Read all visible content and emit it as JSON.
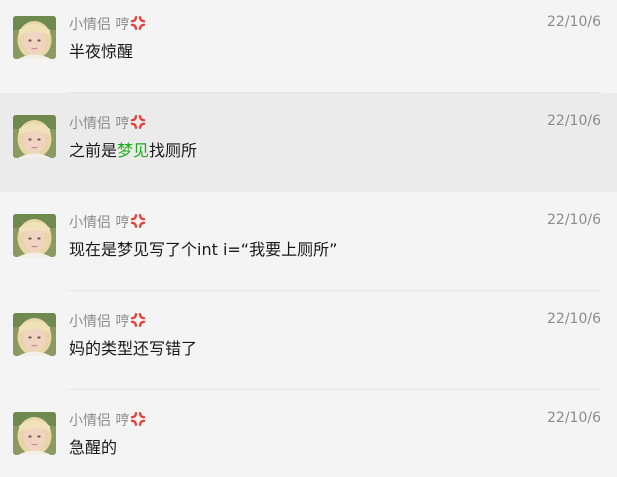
{
  "colors": {
    "background": "#f4f4f4",
    "highlight_row": "#ebebeb",
    "name_text": "#8c8c8c",
    "message_text": "#191919",
    "link_green": "#1aad19",
    "anger_emoji": "#e8413c"
  },
  "messages": [
    {
      "avatar": "avatar-photo",
      "name": "小情侣 哼",
      "emoji": "anger-symbol-icon",
      "time": "22/10/6",
      "text_parts": [
        {
          "text": "半夜惊醒",
          "style": "normal"
        }
      ],
      "highlighted": false
    },
    {
      "avatar": "avatar-photo",
      "name": "小情侣 哼",
      "emoji": "anger-symbol-icon",
      "time": "22/10/6",
      "text_parts": [
        {
          "text": "之前是",
          "style": "normal"
        },
        {
          "text": "梦见",
          "style": "green"
        },
        {
          "text": "找厕所",
          "style": "normal"
        }
      ],
      "highlighted": true
    },
    {
      "avatar": "avatar-photo",
      "name": "小情侣 哼",
      "emoji": "anger-symbol-icon",
      "time": "22/10/6",
      "text_parts": [
        {
          "text": "现在是梦见写了个int i=“我要上厕所”",
          "style": "normal"
        }
      ],
      "highlighted": false
    },
    {
      "avatar": "avatar-photo",
      "name": "小情侣 哼",
      "emoji": "anger-symbol-icon",
      "time": "22/10/6",
      "text_parts": [
        {
          "text": "妈的类型还写错了",
          "style": "normal"
        }
      ],
      "highlighted": false
    },
    {
      "avatar": "avatar-photo",
      "name": "小情侣 哼",
      "emoji": "anger-symbol-icon",
      "time": "22/10/6",
      "text_parts": [
        {
          "text": "急醒的",
          "style": "normal"
        }
      ],
      "highlighted": false
    }
  ]
}
